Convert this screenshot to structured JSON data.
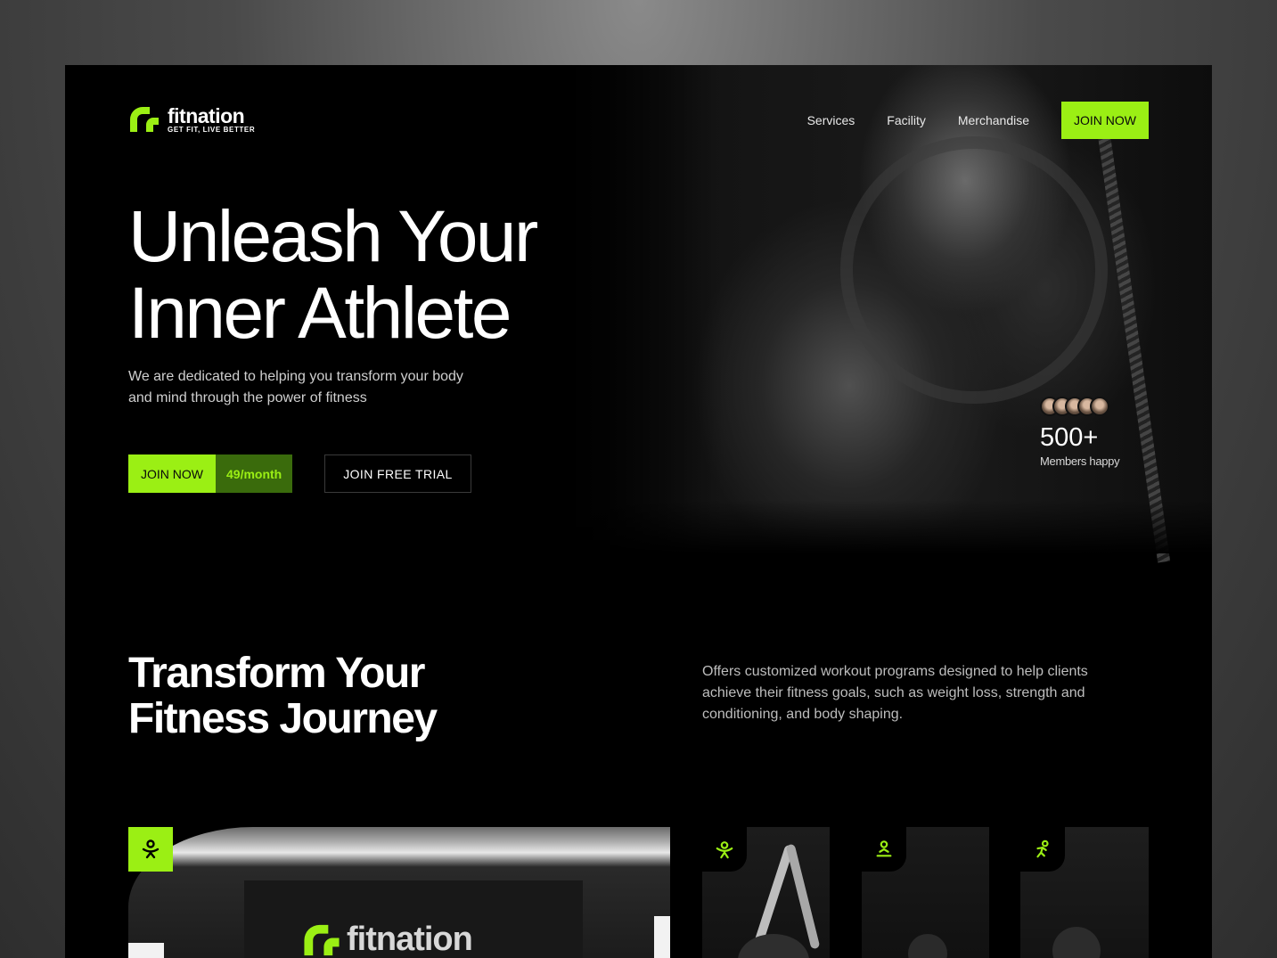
{
  "brand": {
    "name": "fitnation",
    "tagline": "GET FIT, LIVE BETTER",
    "accent_color": "#9bef14",
    "background_color": "#000000"
  },
  "nav": {
    "items": [
      {
        "label": "Services"
      },
      {
        "label": "Facility"
      },
      {
        "label": "Merchandise"
      }
    ],
    "join_label": "JOIN NOW"
  },
  "hero": {
    "title_line1": "Unleash Your",
    "title_line2": "Inner Athlete",
    "subtitle": "We are dedicated to helping you transform your body and mind through the power of fitness",
    "join_label": "JOIN NOW",
    "price_label": "49/month",
    "trial_label": "JOIN FREE TRIAL"
  },
  "members": {
    "count": "500+",
    "label": "Members happy"
  },
  "transform": {
    "title_line1": "Transform Your",
    "title_line2": "Fitness Journey",
    "description": "Offers customized workout programs designed to help clients achieve their fitness goals, such as weight loss, strength and conditioning, and body shaping."
  },
  "cards": {
    "facility_sign": "fitnation",
    "icons": [
      "person-icon",
      "stretch-icon",
      "yoga-icon",
      "run-icon"
    ]
  }
}
